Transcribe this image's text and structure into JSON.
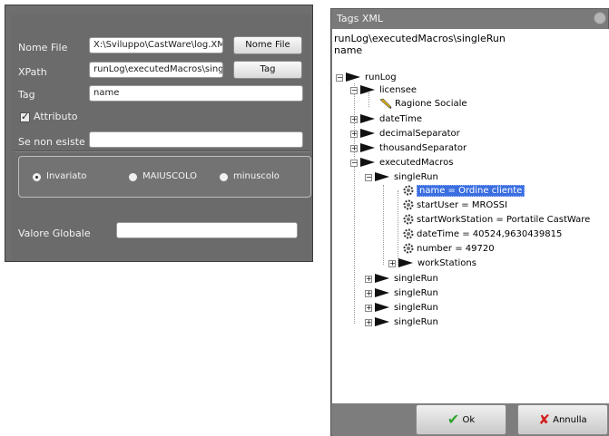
{
  "left": {
    "nome_file_label": "Nome File",
    "nome_file_value": "X:\\Sviluppo\\CastWare\\log.XML",
    "nome_file_button": "Nome File",
    "xpath_label": "XPath",
    "xpath_value": "runLog\\executedMacros\\singleRun",
    "tag_button": "Tag",
    "tag_label": "Tag",
    "tag_value": "name",
    "attributo_label": "Attributo",
    "attributo_checked": true,
    "se_non_esiste_label": "Se non esiste",
    "se_non_esiste_value": "",
    "case_options": [
      "Invariato",
      "MAIUSCOLO",
      "minuscolo"
    ],
    "case_selected": "Invariato",
    "valore_globale_label": "Valore Globale",
    "valore_globale_value": ""
  },
  "dialog": {
    "title": "Tags XML",
    "path": "runLog\\executedMacros\\singleRun",
    "name": "name",
    "tree": {
      "root": "runLog",
      "licensee": "licensee",
      "ragione_sociale": "Ragione Sociale",
      "dateTime": "dateTime",
      "decimalSeparator": "decimalSeparator",
      "thousandSeparator": "thousandSeparator",
      "executedMacros": "executedMacros",
      "singleRun": "singleRun",
      "attr_name": "name = Ordine cliente",
      "attr_startUser": "startUser = MROSSI",
      "attr_startWorkStation": "startWorkStation = Portatile CastWare",
      "attr_dateTime": "dateTime = 40524,9630439815",
      "attr_number": "number = 49720",
      "workStations": "workStations",
      "more_singleRun": [
        "singleRun",
        "singleRun",
        "singleRun",
        "singleRun"
      ]
    },
    "ok_label": "Ok",
    "annulla_label": "Annulla"
  },
  "colors": {
    "panel_bg": "#6b6b6b",
    "selection": "#3b6fe0",
    "ok_check": "#2fa42f",
    "cancel_x": "#d42020"
  }
}
